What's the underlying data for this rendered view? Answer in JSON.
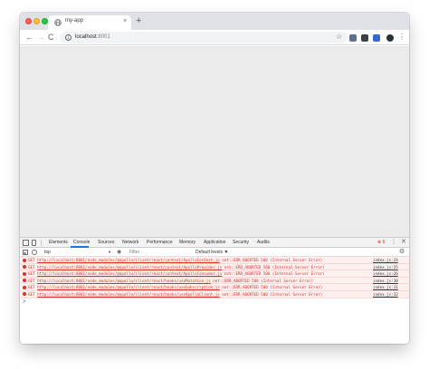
{
  "window": {
    "tab_title": "my-app",
    "tab_close": "×",
    "new_tab": "+"
  },
  "toolbar": {
    "back": "←",
    "forward": "→",
    "reload": "C",
    "info": "i",
    "url_host": "localhost",
    "url_port": ":8001",
    "star": "☆",
    "menu": "⋮"
  },
  "devtools": {
    "tabs": [
      "Elements",
      "Console",
      "Sources",
      "Network",
      "Performance",
      "Memory",
      "Application",
      "Security",
      "Audits"
    ],
    "active_tab": "Console",
    "error_count": "6",
    "kebab": "⋮",
    "close": "✕",
    "filterbar": {
      "context": "top",
      "context_arrow": "▼",
      "eye": "◉",
      "filter_placeholder": "Filter",
      "levels": "Default levels ▼",
      "gear": "⚙"
    },
    "console": {
      "prompt": ">",
      "rows": [
        {
          "method": "GET",
          "url": "http://localhost:8001/node_modules/@apollo/client/react/context/ApolloContext.js",
          "error": "net::ERR_ABORTED 500 (Internal Server Error)",
          "source": "index.js:24"
        },
        {
          "method": "GET",
          "url": "http://localhost:8001/node_modules/@apollo/client/react/context/ApolloProvider.js",
          "error": "net::ERR_ABORTED 500 (Internal Server Error)",
          "source": "index.js:25"
        },
        {
          "method": "GET",
          "url": "http://localhost:8001/node_modules/@apollo/client/react/context/ApolloConsumer.js",
          "error": "net::ERR_ABORTED 500 (Internal Server Error)",
          "source": "index.js:26"
        },
        {
          "method": "GET",
          "url": "http://localhost:8001/node_modules/@apollo/client/react/hooks/useMutation.js",
          "error": "net::ERR_ABORTED 500 (Internal Server Error)",
          "source": "index.js:30"
        },
        {
          "method": "GET",
          "url": "http://localhost:8001/node_modules/@apollo/client/react/hooks/useSubscription.js",
          "error": "net::ERR_ABORTED 500 (Internal Server Error)",
          "source": "index.js:31"
        },
        {
          "method": "GET",
          "url": "http://localhost:8001/node_modules/@apollo/client/react/hooks/useApolloClient.js",
          "error": "net::ERR_ABORTED 500 (Internal Server Error)",
          "source": "index.js:32"
        }
      ]
    }
  },
  "colors": {
    "error_red": "#d93025",
    "error_bg": "#fff0f0",
    "viewport_bg": "#ebebeb",
    "accent_blue": "#1a73e8"
  }
}
